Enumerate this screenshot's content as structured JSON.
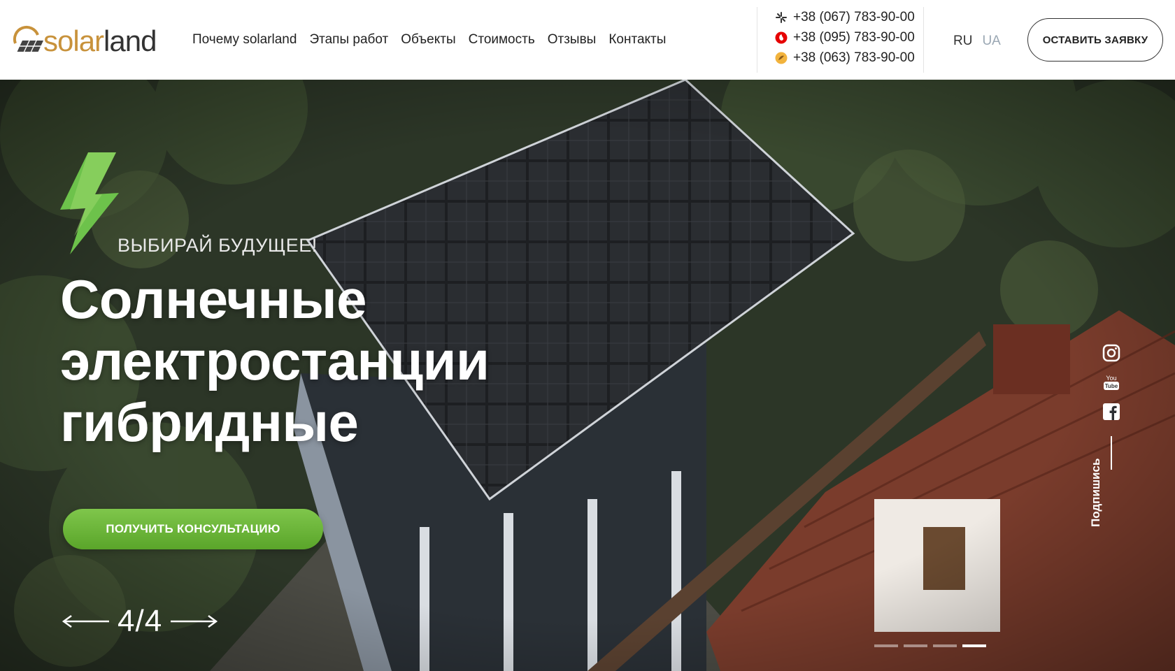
{
  "brand": {
    "logo_solar": "solar",
    "logo_land": "land",
    "accent_color": "#c8923b"
  },
  "nav": {
    "items": [
      {
        "label": "Почему solarland"
      },
      {
        "label": "Этапы работ"
      },
      {
        "label": "Объекты"
      },
      {
        "label": "Стоимость"
      },
      {
        "label": "Отзывы"
      },
      {
        "label": "Контакты"
      }
    ]
  },
  "phones": [
    {
      "number": "+38 (067) 783-90-00",
      "icon": "kyivstar-icon"
    },
    {
      "number": "+38 (095) 783-90-00",
      "icon": "vodafone-icon"
    },
    {
      "number": "+38 (063) 783-90-00",
      "icon": "lifecell-icon"
    }
  ],
  "lang": {
    "active": "RU",
    "other": "UA"
  },
  "header_cta": "ОСТАВИТЬ ЗАЯВКУ",
  "hero": {
    "tagline": "ВЫБИРАЙ БУДУЩЕЕ!",
    "headline_line1": "Солнечные",
    "headline_line2": "электростанции",
    "headline_line3": "гибридные",
    "cta": "ПОЛУЧИТЬ КОНСУЛЬТАЦИЮ",
    "slide_counter": "4/4",
    "subscribe": "Подпишись",
    "cta_color": "#6cb83a"
  },
  "social": [
    "instagram-icon",
    "youtube-icon",
    "facebook-icon"
  ],
  "slider": {
    "total": 4,
    "active_index": 4
  }
}
